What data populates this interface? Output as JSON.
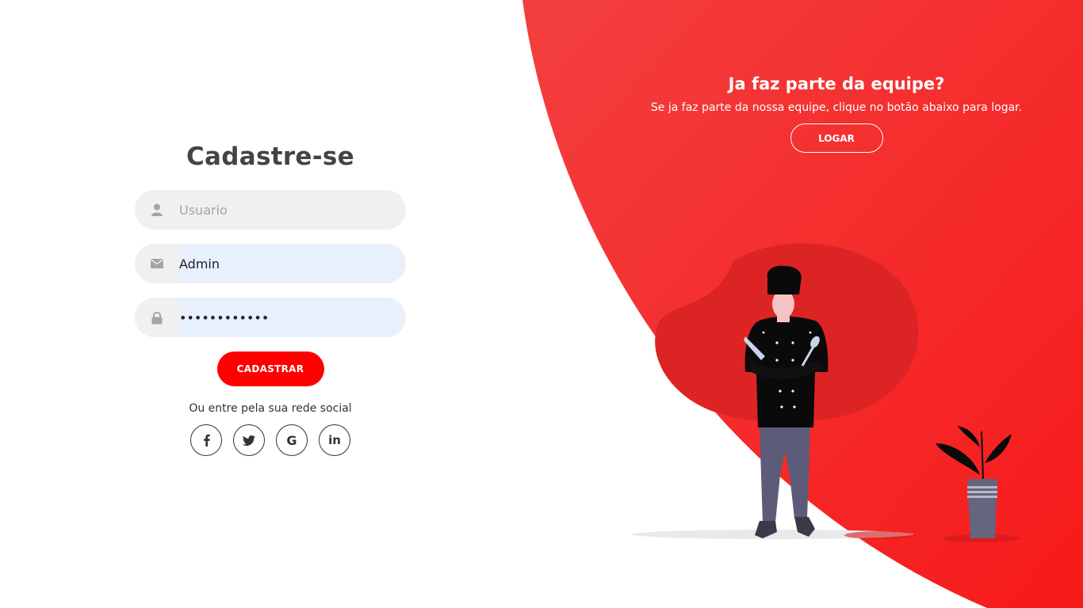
{
  "signup": {
    "title": "Cadastre-se",
    "username_placeholder": "Usuario",
    "username_value": "",
    "email_value": "Admin",
    "password_value": "123456789012",
    "submit_label": "CADASTRAR",
    "social_text": "Ou entre pela sua rede social",
    "social": [
      {
        "icon": "facebook-icon",
        "glyph": "f"
      },
      {
        "icon": "twitter-icon",
        "glyph": "twitter"
      },
      {
        "icon": "google-icon",
        "glyph": "G"
      },
      {
        "icon": "linkedin-icon",
        "glyph": "in"
      }
    ]
  },
  "panel": {
    "title": "Ja faz parte da equipe?",
    "text": "Se ja faz parte da nossa equipe, clique no botão abaixo para logar.",
    "login_label": "LOGAR"
  },
  "colors": {
    "accent": "#ff0000",
    "panel_gradient_start": "#f33b3b",
    "panel_gradient_end": "#f71c1c",
    "input_bg": "#f0f0f0",
    "autofill_bg": "#e8f0fe"
  }
}
